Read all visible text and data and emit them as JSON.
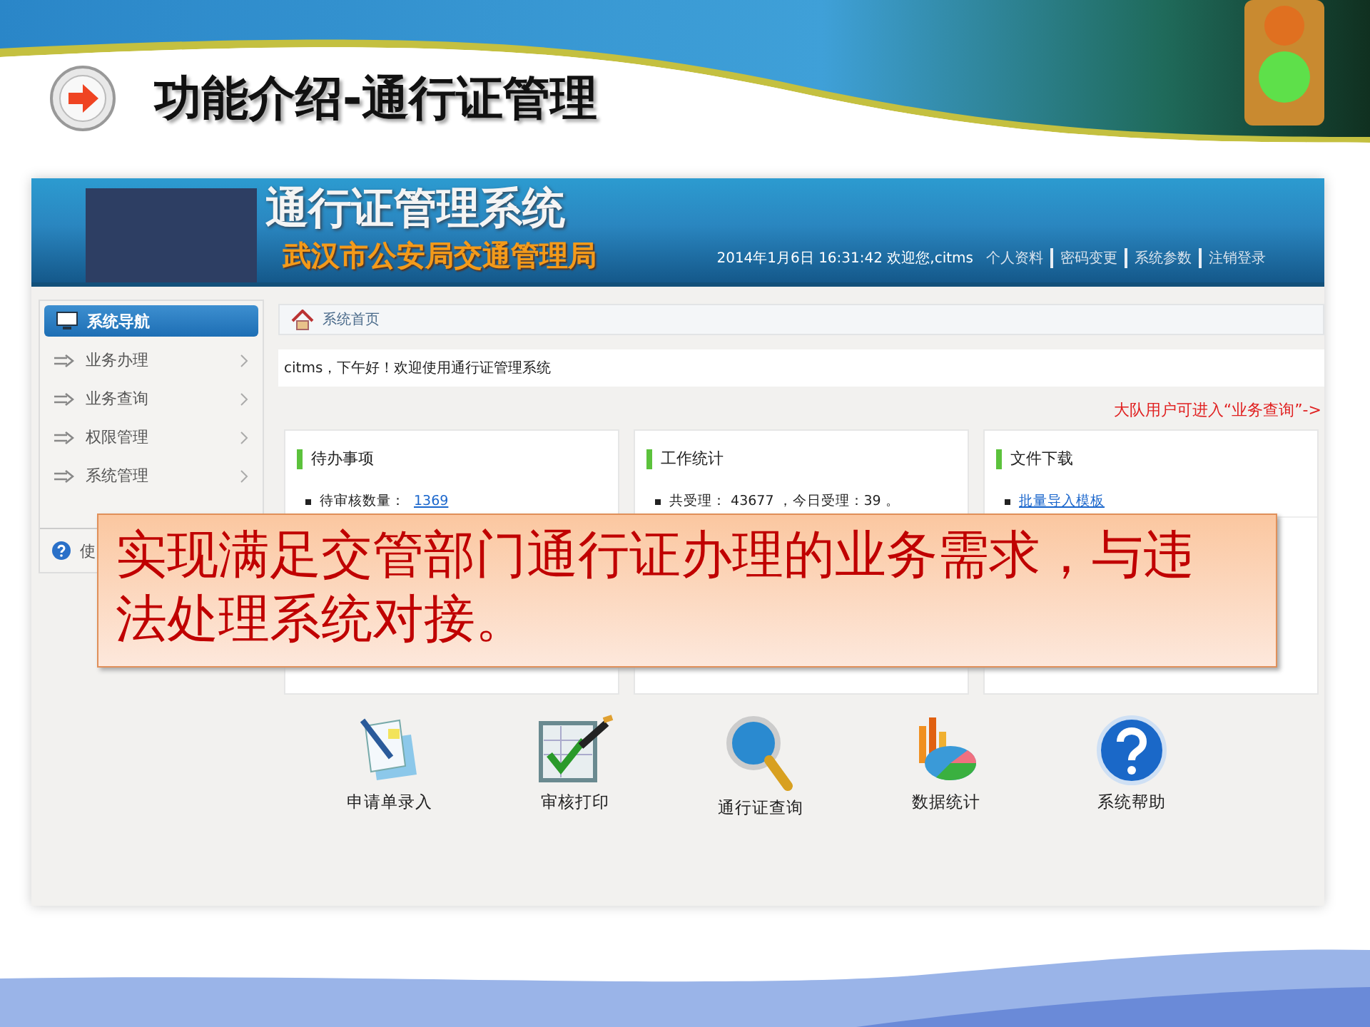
{
  "slide": {
    "title": "功能介绍-通行证管理",
    "callout": "实现满足交管部门通行证办理的业务需求，与违法处理系统对接。"
  },
  "app": {
    "title": "通行证管理系统",
    "subtitle": "武汉市公安局交通管理局",
    "status": "2014年1月6日 16:31:42 欢迎您,citms",
    "header_links": [
      "个人资料",
      "密码变更",
      "系统参数",
      "注销登录"
    ]
  },
  "sidebar": {
    "title": "系统导航",
    "items": [
      "业务办理",
      "业务查询",
      "权限管理",
      "系统管理"
    ],
    "help": "使"
  },
  "breadcrumb": "系统首页",
  "greeting": "citms，下午好！欢迎使用通行证管理系统",
  "notice": "大队用户可进入“业务查询”->",
  "cards": [
    {
      "title": "待办事项",
      "items": [
        {
          "label": "待审核数量：",
          "link": "1369"
        }
      ]
    },
    {
      "title": "工作统计",
      "items": [
        {
          "label": "共受理： 43677 ，今日受理：39 。"
        }
      ]
    },
    {
      "title": "文件下载",
      "items": [
        {
          "link": "批量导入模板"
        }
      ]
    }
  ],
  "shortcuts": [
    {
      "label": "申请单录入",
      "kind": "form"
    },
    {
      "label": "审核打印",
      "kind": "check"
    },
    {
      "label": "通行证查询",
      "kind": "search"
    },
    {
      "label": "数据统计",
      "kind": "chart"
    },
    {
      "label": "系统帮助",
      "kind": "help"
    }
  ]
}
